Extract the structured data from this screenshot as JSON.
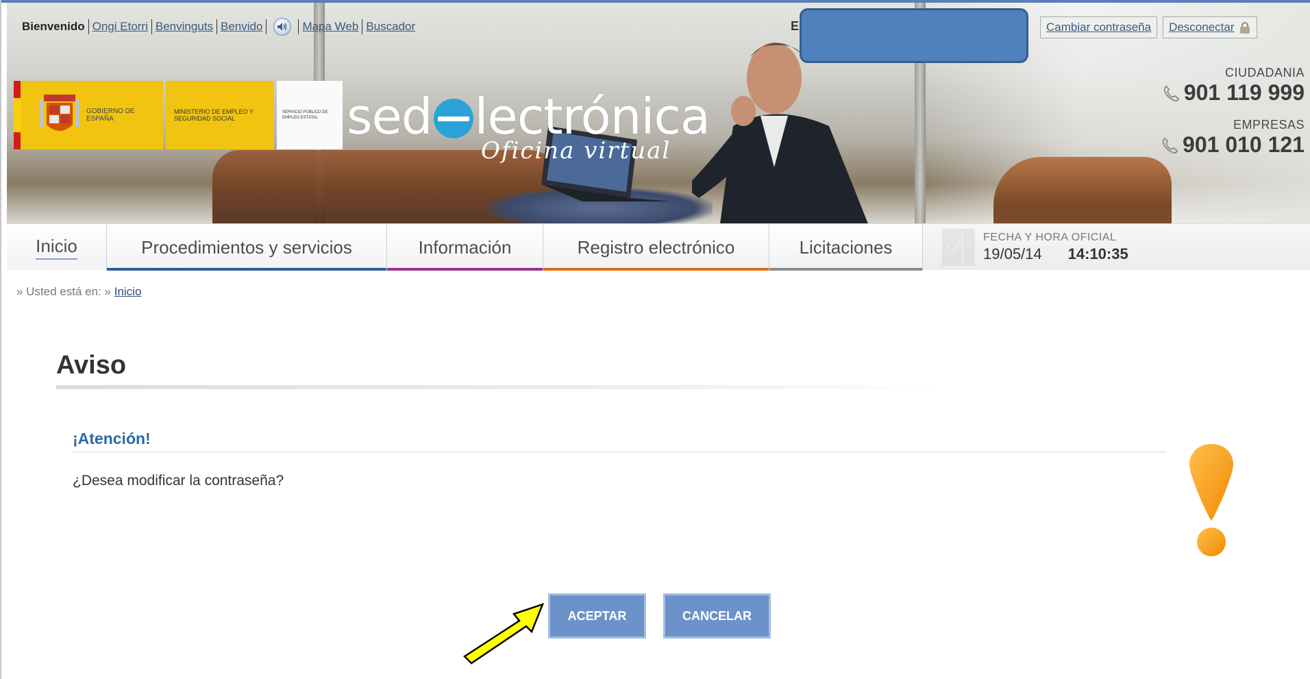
{
  "topbar": {
    "welcome": "Bienvenido",
    "lang_eu": "Ongi Etorri",
    "lang_ca": "Benvinguts",
    "lang_gl": "Benvido",
    "sitemap": "Mapa Web",
    "search": "Buscador",
    "redacted_initial": "E"
  },
  "account": {
    "change_password": "Cambiar contraseña",
    "logout": "Desconectar"
  },
  "logos": {
    "gobierno": "GOBIERNO DE ESPAÑA",
    "ministerio": "MINISTERIO DE EMPLEO Y SEGURIDAD SOCIAL",
    "sepe": "SERVICIO PÚBLICO DE EMPLEO ESTATAL"
  },
  "brand": {
    "part1": "sed",
    "part2": "lectrónica",
    "tagline": "Oficina virtual"
  },
  "phones": {
    "citizens_label": "CIUDADANIA",
    "citizens_number": "901 119 999",
    "companies_label": "EMPRESAS",
    "companies_number": "901 010 121"
  },
  "nav": {
    "tabs": [
      {
        "label": "Inicio"
      },
      {
        "label": "Procedimientos y servicios"
      },
      {
        "label": "Información"
      },
      {
        "label": "Registro electrónico"
      },
      {
        "label": "Licitaciones"
      }
    ],
    "clock_label": "FECHA Y HORA OFICIAL",
    "date": "19/05/14",
    "time": "14:10:35"
  },
  "breadcrumb": {
    "prefix": "» Usted está en: »",
    "current": "Inicio"
  },
  "main": {
    "title": "Aviso",
    "attention": "¡Atención!",
    "question": "¿Desea modificar la contraseña?",
    "accept": "ACEPTAR",
    "cancel": "CANCELAR"
  },
  "colors": {
    "accent_blue": "#6b93c9",
    "heading_blue": "#2b6aa6",
    "warning_orange": "#f39c12",
    "arrow_yellow": "#ffff00"
  }
}
